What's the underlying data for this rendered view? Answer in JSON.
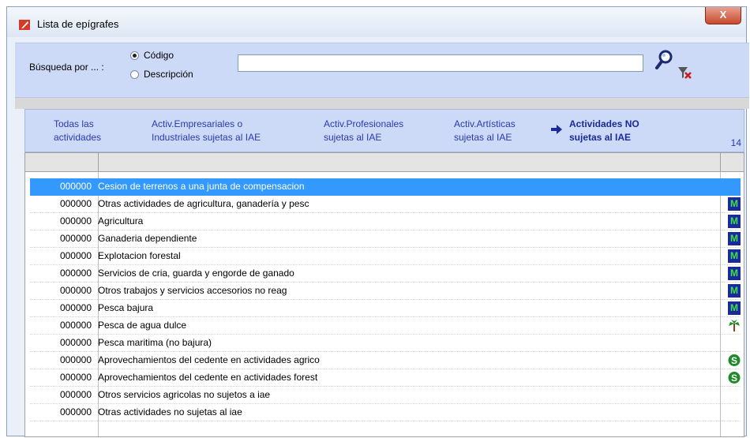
{
  "window": {
    "title": "Lista de epígrafes",
    "close_label": "X"
  },
  "search": {
    "label": "Búsqueda por ... :",
    "options": [
      {
        "label": "Código",
        "selected": true
      },
      {
        "label": "Descripción",
        "selected": false
      }
    ],
    "value": "",
    "placeholder": ""
  },
  "tabs": [
    {
      "line1": "Todas las",
      "line2": "actividades",
      "active": false
    },
    {
      "line1": "Activ.Empresariales o",
      "line2": "Industriales sujetas al IAE",
      "active": false
    },
    {
      "line1": "Activ.Profesionales",
      "line2": "sujetas al IAE",
      "active": false
    },
    {
      "line1": "Activ.Artísticas",
      "line2": "sujetas al IAE",
      "active": false
    },
    {
      "line1": "Actividades NO",
      "line2": "sujetas al IAE",
      "active": true
    }
  ],
  "record_count": "14",
  "rows": [
    {
      "code": "000000",
      "desc": "Cesion de terrenos a una junta de compensacion",
      "mark": "",
      "selected": true
    },
    {
      "code": "000000",
      "desc": "Otras actividades de agricultura, ganadería y pesc",
      "mark": "M"
    },
    {
      "code": "000000",
      "desc": "Agricultura",
      "mark": "M"
    },
    {
      "code": "000000",
      "desc": "Ganaderia dependiente",
      "mark": "M"
    },
    {
      "code": "000000",
      "desc": "Explotacion forestal",
      "mark": "M"
    },
    {
      "code": "000000",
      "desc": "Servicios de cria, guarda y engorde de ganado",
      "mark": "M"
    },
    {
      "code": "000000",
      "desc": "Otros trabajos y servicios accesorios no reag",
      "mark": "M"
    },
    {
      "code": "000000",
      "desc": "Pesca bajura",
      "mark": "M"
    },
    {
      "code": "000000",
      "desc": "Pesca de agua dulce",
      "mark": "tree"
    },
    {
      "code": "000000",
      "desc": "Pesca maritima (no bajura)",
      "mark": ""
    },
    {
      "code": "000000",
      "desc": "Aprovechamientos del cedente en actividades agrico",
      "mark": "S"
    },
    {
      "code": "000000",
      "desc": "Aprovechamientos del cedente en actividades forest",
      "mark": "S"
    },
    {
      "code": "000000",
      "desc": "Otros servicios agricolas no sujetos a iae",
      "mark": ""
    },
    {
      "code": "000000",
      "desc": "Otras actividades no sujetas al iae",
      "mark": ""
    }
  ],
  "colors": {
    "selection": "#3399ff",
    "tab_text": "#2a3ab0",
    "panel": "#ccd9f7",
    "mark_m_bg": "#1a2a9a",
    "mark_m_fg": "#3de04a",
    "mark_s": "#1e8a2a"
  }
}
